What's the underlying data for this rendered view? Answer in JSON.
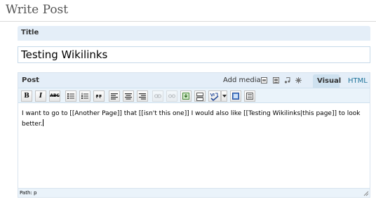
{
  "page": {
    "title": "Write Post"
  },
  "title_section": {
    "heading": "Title",
    "value": "Testing Wikilinks"
  },
  "post_section": {
    "heading": "Post",
    "add_media_label": "Add media:",
    "tabs": {
      "visual": "Visual",
      "html": "HTML"
    },
    "toolbar": {
      "bold": "B",
      "italic": "I",
      "strikethrough": "ABC"
    },
    "content": "I want to go to [[Another Page]] that [[isn't this one]] I would also like [[Testing Wikilinks|this page]] to look better.",
    "path": "Path: p"
  },
  "colors": {
    "accent": "#21759b",
    "header_bg": "#e4eef8",
    "toolbar_bg": "#eaf3fa"
  },
  "icons": [
    "image-icon",
    "video-icon",
    "audio-icon",
    "media-icon",
    "bullet-list-icon",
    "numbered-list-icon",
    "blockquote-icon",
    "align-left-icon",
    "align-center-icon",
    "align-right-icon",
    "link-icon",
    "unlink-icon",
    "insert-image-icon",
    "more-tag-icon",
    "spellcheck-icon",
    "dropdown-arrow-icon",
    "fullscreen-icon",
    "kitchen-sink-icon",
    "resize-handle-icon"
  ]
}
